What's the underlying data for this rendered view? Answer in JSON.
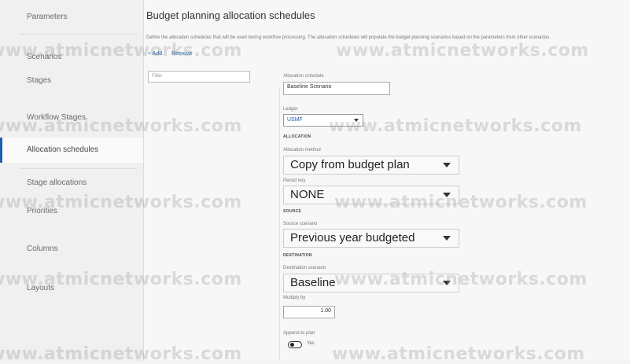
{
  "sidebar": {
    "items": [
      {
        "label": "Parameters"
      },
      {
        "label": "Scenarios"
      },
      {
        "label": "Stages"
      },
      {
        "label": "Workflow Stages"
      },
      {
        "label": "Allocation schedules"
      },
      {
        "label": "Stage allocations"
      },
      {
        "label": "Priorities"
      },
      {
        "label": "Columns"
      },
      {
        "label": "Layouts"
      }
    ],
    "active_index": 4
  },
  "header": {
    "title": "Budget planning allocation schedules",
    "description": "Define the allocation schedules that will be used during workflow processing. The allocation schedules will populate the budget planning scenarios based on the parameters from other scenarios.",
    "add_label": "+ Add",
    "remove_label": "Remove"
  },
  "filter": {
    "placeholder": "Filter"
  },
  "form": {
    "allocation_schedule_label": "Allocation schedule",
    "allocation_schedule_value": "Baseline Scenario",
    "ledger_label": "Ledger",
    "ledger_value": "USMF",
    "allocation_section": "ALLOCATION",
    "allocation_method_label": "Allocation method",
    "allocation_method_value": "Copy from budget plan",
    "period_key_label": "Period key",
    "period_key_value": "NONE",
    "source_section": "SOURCE",
    "source_scenario_label": "Source scenario",
    "source_scenario_value": "Previous year budgeted",
    "destination_section": "DESTINATION",
    "destination_scenario_label": "Destination scenario",
    "destination_scenario_value": "Baseline",
    "multiply_by_label": "Multiply by",
    "multiply_by_value": "1.00",
    "append_label": "Append to plan",
    "append_value": "Yes"
  },
  "watermark": {
    "text": "www.atmicnetworks.com"
  },
  "colors": {
    "accent": "#1a5fb4"
  }
}
